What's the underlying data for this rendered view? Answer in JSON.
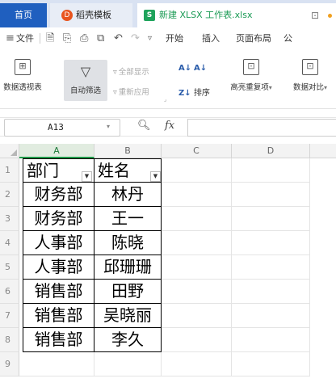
{
  "tabs": {
    "home": "首页",
    "template": "稻壳模板",
    "document": "新建 XLSX 工作表.xlsx",
    "template_logo": "D",
    "document_logo": "S",
    "pin_icon": "⊡"
  },
  "menu": {
    "file": "文件",
    "items": [
      "开始",
      "插入",
      "页面布局",
      "公"
    ]
  },
  "ribbon": {
    "pivot": "数据透视表",
    "autofilter": "自动筛选",
    "show_all": "全部显示",
    "reapply": "重新应用",
    "sort": "排序",
    "highlight_dup": "高亮重复项",
    "data_compare": "数据对比"
  },
  "formula_bar": {
    "cell_ref": "A13",
    "fx": "fx",
    "value": ""
  },
  "sheet": {
    "columns": [
      "A",
      "B",
      "C",
      "D"
    ],
    "rows": [
      "1",
      "2",
      "3",
      "4",
      "5",
      "6",
      "7",
      "8",
      "9"
    ],
    "table": [
      [
        "部门",
        "姓名"
      ],
      [
        "财务部",
        "林丹"
      ],
      [
        "财务部",
        "王一"
      ],
      [
        "人事部",
        "陈晓"
      ],
      [
        "人事部",
        "邱珊珊"
      ],
      [
        "销售部",
        "田野"
      ],
      [
        "销售部",
        "吴晓丽"
      ],
      [
        "销售部",
        "李久"
      ]
    ]
  },
  "colors": {
    "accent": "#1f5fbf",
    "active_column": "#1e9a49",
    "doc_tab_text": "#1a9a54"
  }
}
